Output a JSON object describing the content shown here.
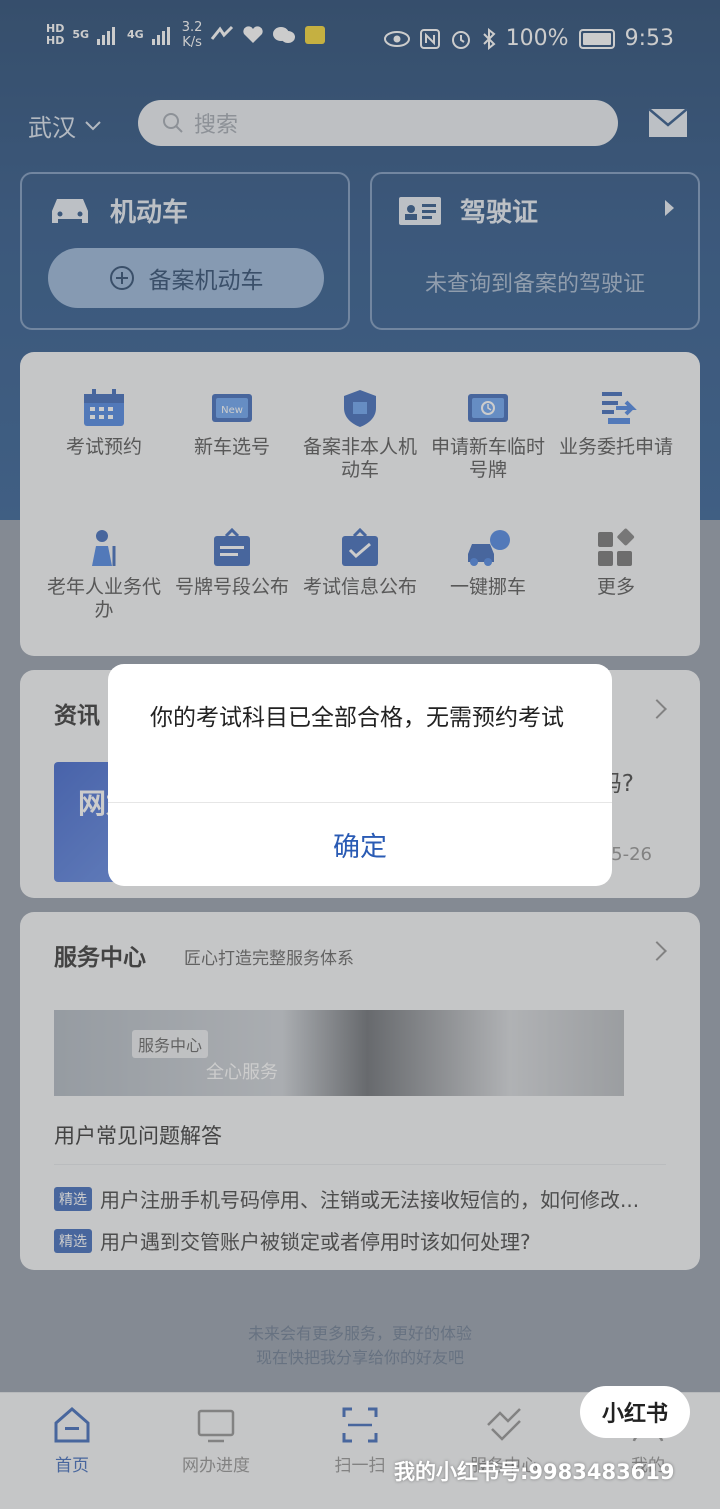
{
  "status_bar": {
    "hd1": "HD",
    "hd2": "HD",
    "net1": "5G",
    "net2": "4G",
    "speed_value": "3.2",
    "speed_unit": "K/s",
    "battery": "100%",
    "time": "9:53"
  },
  "header": {
    "city": "武汉",
    "search_placeholder": "搜索"
  },
  "vehicle_card": {
    "title": "机动车",
    "button_label": "备案机动车"
  },
  "license_card": {
    "title": "驾驶证",
    "status": "未查询到备案的驾驶证"
  },
  "services": [
    {
      "label": "考试预约",
      "icon": "calendar-icon"
    },
    {
      "label": "新车选号",
      "icon": "new-plate-icon"
    },
    {
      "label": "备案非本人机动车",
      "icon": "shield-icon"
    },
    {
      "label": "申请新车临时号牌",
      "icon": "temp-plate-icon"
    },
    {
      "label": "业务委托申请",
      "icon": "delegate-icon"
    },
    {
      "label": "老年人业务代办",
      "icon": "elderly-icon"
    },
    {
      "label": "号牌号段公布",
      "icon": "plate-range-icon"
    },
    {
      "label": "考试信息公布",
      "icon": "exam-info-icon"
    },
    {
      "label": "一键挪车",
      "icon": "move-car-icon"
    },
    {
      "label": "更多",
      "icon": "more-icon"
    }
  ],
  "news": {
    "title": "资讯",
    "thumb_text": "网龙",
    "headline_tail": "吗?",
    "date_tail": "5-26"
  },
  "service_center": {
    "title": "服务中心",
    "subtitle": "匠心打造完整服务体系",
    "banner_tag": "服务中心",
    "banner_text": "全心服务",
    "faq_heading": "用户常见问题解答",
    "faq": [
      {
        "badge": "精选",
        "text": "用户注册手机号码停用、注销或无法接收短信的，如何修改..."
      },
      {
        "badge": "精选",
        "text": "用户遇到交管账户被锁定或者停用时该如何处理?"
      }
    ]
  },
  "footer": {
    "line1": "未来会有更多服务，更好的体验",
    "line2": "现在快把我分享给你的好友吧"
  },
  "bottom_nav": [
    {
      "label": "首页",
      "icon": "home-icon"
    },
    {
      "label": "网办进度",
      "icon": "progress-icon"
    },
    {
      "label": "扫一扫",
      "icon": "scan-icon"
    },
    {
      "label": "服务中心",
      "icon": "handshake-icon"
    },
    {
      "label": "我的",
      "icon": "profile-icon"
    }
  ],
  "dialog": {
    "message": "你的考试科目已全部合格，无需预约考试",
    "confirm_label": "确定"
  },
  "watermark": {
    "badge": "小红书",
    "text": "我的小红书号:9983483619"
  },
  "colors": {
    "brand_blue": "#2a5bb4",
    "header_dark": "#0e3564"
  }
}
